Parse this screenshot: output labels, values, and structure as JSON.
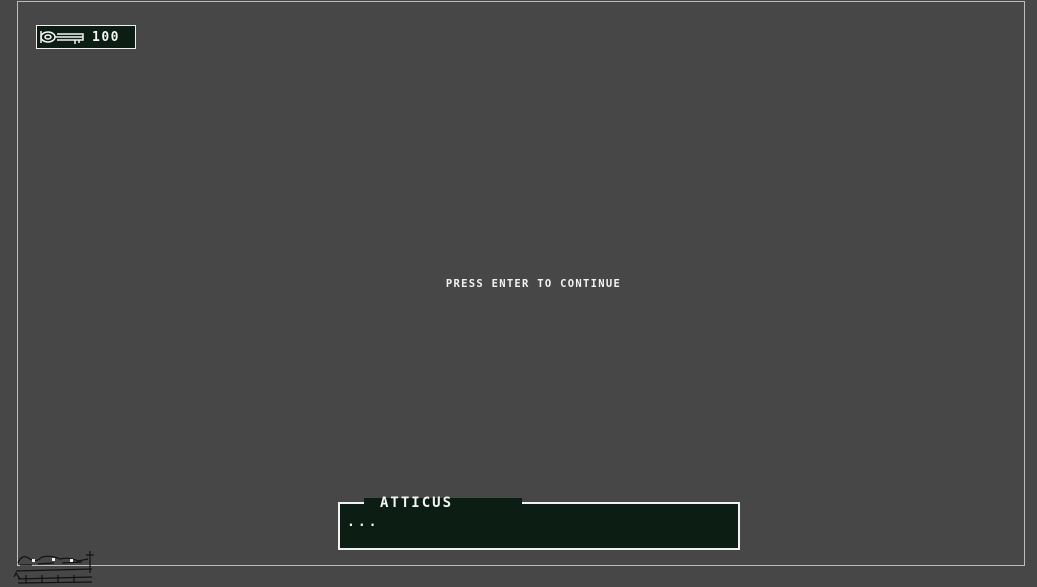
{
  "hud": {
    "currency_icon": "key-icon",
    "count": "100"
  },
  "prompt": "PRESS ENTER TO CONTINUE",
  "dialog": {
    "speaker": "ATTICUS",
    "text": "..."
  },
  "colors": {
    "background": "#474747",
    "panel": "#0c1d14",
    "border": "#f2f2f2",
    "text": "#f4f4f4"
  }
}
